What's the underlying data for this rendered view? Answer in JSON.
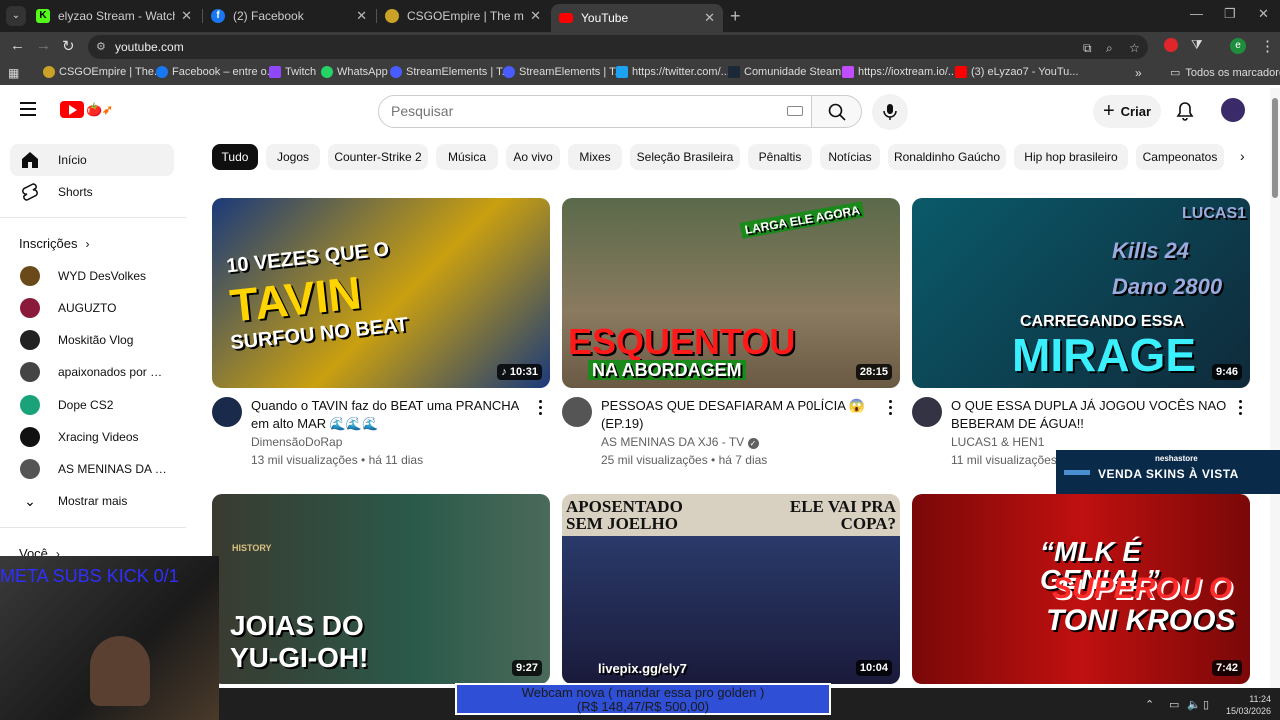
{
  "browser": {
    "tabs": [
      {
        "label": "elyzao Stream - Watch Live on",
        "favicon": "kick-icon",
        "color": "#53fc18",
        "glyph": "K"
      },
      {
        "label": "(2) Facebook",
        "favicon": "facebook-icon",
        "color": "#1877f2",
        "glyph": "f"
      },
      {
        "label": "CSGOEmpire | The most truste",
        "favicon": "csgoempire-icon",
        "color": "#c9a227",
        "glyph": ""
      },
      {
        "label": "YouTube",
        "favicon": "youtube-icon",
        "color": "#ff0000",
        "glyph": ""
      }
    ],
    "url": "youtube.com",
    "bookmarks": [
      {
        "label": "CSGOEmpire | The...",
        "color": "#c9a227"
      },
      {
        "label": "Facebook – entre o...",
        "color": "#1877f2"
      },
      {
        "label": "Twitch",
        "color": "#9146ff"
      },
      {
        "label": "WhatsApp",
        "color": "#25d366"
      },
      {
        "label": "StreamElements | T...",
        "color": "#4a5bff"
      },
      {
        "label": "StreamElements | T...",
        "color": "#4a5bff"
      },
      {
        "label": "https://twitter.com/...",
        "color": "#1da1f2"
      },
      {
        "label": "Comunidade Steam...",
        "color": "#1b2838"
      },
      {
        "label": "https://ioxtream.io/...",
        "color": "#c04dff"
      },
      {
        "label": "(3) eLyzao7 - YouTu...",
        "color": "#ff0000"
      }
    ],
    "bookmarks_folder": "Todos os marcadores",
    "profile_letter": "e"
  },
  "youtube": {
    "search_placeholder": "Pesquisar",
    "create_label": "Criar",
    "sidebar": {
      "main": [
        {
          "label": "Início",
          "icon": "home-icon"
        },
        {
          "label": "Shorts",
          "icon": "shorts-icon"
        }
      ],
      "subscriptions_heading": "Inscrições",
      "subscriptions": [
        {
          "label": "WYD DesVolkes",
          "color": "#6b4a1a"
        },
        {
          "label": "AUGUZTO",
          "color": "#8a1a3a"
        },
        {
          "label": "Moskitão Vlog",
          "color": "#222222"
        },
        {
          "label": "apaixonados por m...",
          "color": "#444444"
        },
        {
          "label": "Dope CS2",
          "color": "#1aa37a"
        },
        {
          "label": "Xracing Videos",
          "color": "#111111"
        },
        {
          "label": "AS MENINAS DA X...",
          "color": "#555555"
        }
      ],
      "show_more": "Mostrar mais",
      "you_heading": "Você"
    },
    "chips": [
      "Tudo",
      "Jogos",
      "Counter-Strike 2",
      "Música",
      "Ao vivo",
      "Mixes",
      "Seleção Brasileira",
      "Pênaltis",
      "Notícias",
      "Ronaldinho Gaúcho",
      "Hip hop brasileiro",
      "Campeonatos"
    ],
    "videos": [
      {
        "title": "Quando o TAVIN faz do BEAT uma PRANCHA em alto MAR 🌊🌊🌊",
        "channel": "DimensãoDoRap",
        "views": "13 mil visualizações",
        "age": "há 11 dias",
        "duration": "♪ 10:31",
        "thumb_lines": [
          "10 VEZES QUE O",
          "TAVIN",
          "SURFOU NO BEAT"
        ],
        "bg": "#1a4a8a",
        "avatar_color": "#1a2a4a"
      },
      {
        "title": "PESSOAS QUE DESAFIARAM A P0LÍCIA 😱 (EP.19)",
        "channel": "AS MENINAS DA XJ6 - TV",
        "views": "25 mil visualizações",
        "age": "há 7 dias",
        "duration": "28:15",
        "thumb_lines": [
          "LARGA ELE AGORA",
          "ESQUENTOU",
          "NA ABORDAGEM"
        ],
        "bg": "#7a6a50",
        "avatar_color": "#555555",
        "verified": true
      },
      {
        "title": "O QUE ESSA DUPLA JÁ JOGOU VOCÊS NAO BEBERAM DE ÁGUA!!",
        "channel": "LUCAS1 & HEN1",
        "views": "11 mil visualizações",
        "age": "",
        "duration": "9:46",
        "thumb_lines": [
          "LUCAS1",
          "Kills 24",
          "Dano 2800",
          "CARREGANDO ESSA",
          "MIRAGE"
        ],
        "bg": "#0f3a4a",
        "avatar_color": "#333344"
      },
      {
        "title": "",
        "channel": "",
        "views": "",
        "age": "",
        "duration": "9:27",
        "thumb_lines": [
          "HISTORY",
          "JOIAS DO",
          "YU-GI-OH!"
        ],
        "bg": "#2a4a3a",
        "avatar_color": "#333333"
      },
      {
        "title": "",
        "channel": "",
        "views": "",
        "age": "",
        "duration": "10:04",
        "thumb_lines": [
          "APOSENTADO SEM JOELHO",
          "ELE VAI PRA COPA?",
          "livepix.gg/ely7"
        ],
        "bg": "#1a2a6a",
        "avatar_color": "#333333"
      },
      {
        "title": "",
        "channel": "",
        "views": "",
        "age": "",
        "duration": "7:42",
        "thumb_lines": [
          "“MLK É GENIAL”",
          "SUPEROU O",
          "TONI KROOS"
        ],
        "bg": "#b01010",
        "avatar_color": "#333333"
      }
    ]
  },
  "stream_overlay": {
    "webcam_text": "META SUBS KICK 0/1",
    "store_brand": "neshastore",
    "store_message": "VENDA SKINS À VISTA",
    "goal_line1": "Webcam nova ( mandar essa pro golden )",
    "goal_line2": "(R$ 148,47/R$ 500,00)"
  },
  "system": {
    "time": "11:24",
    "date": "15/03/2026"
  }
}
